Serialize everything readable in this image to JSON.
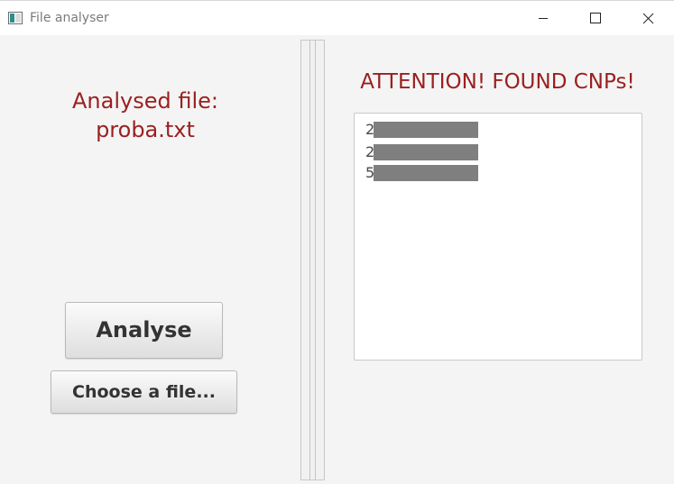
{
  "window": {
    "title": "File analyser",
    "controls": {
      "minimize_icon": "minimize-icon",
      "maximize_icon": "maximize-icon",
      "close_icon": "close-icon"
    }
  },
  "left_pane": {
    "analysed_label": "Analysed file:",
    "analysed_filename": "proba.txt",
    "analyse_button": "Analyse",
    "choose_file_button": "Choose a file..."
  },
  "right_pane": {
    "title": "ATTENTION! FOUND CNPs!",
    "cnp_items": [
      {
        "leading_digit": "2"
      },
      {
        "leading_digit": "2"
      },
      {
        "leading_digit": "5"
      }
    ]
  },
  "colors": {
    "accent_text": "#9b1f1f",
    "redaction": "#7f7f7f"
  }
}
